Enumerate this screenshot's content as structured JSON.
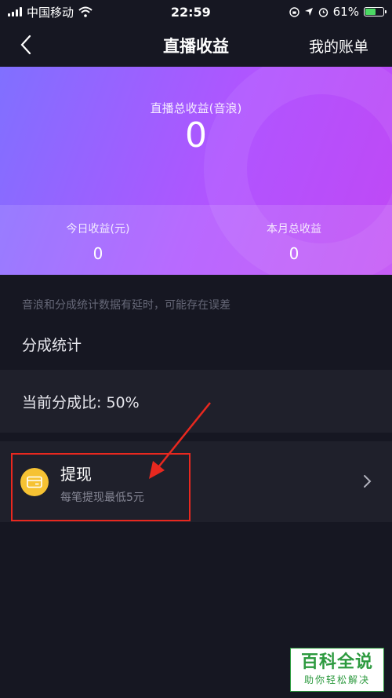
{
  "status_bar": {
    "carrier": "中国移动",
    "time": "22:59",
    "battery_percent": "61%",
    "battery_level": 0.61
  },
  "nav": {
    "title": "直播收益",
    "right_link": "我的账单"
  },
  "earnings": {
    "total_label": "直播总收益(音浪)",
    "total_value": "0",
    "today_label": "今日收益(元)",
    "today_value": "0",
    "month_label": "本月总收益",
    "month_value": "0"
  },
  "notice": "音浪和分成统计数据有延时，可能存在误差",
  "split": {
    "section_title": "分成统计",
    "ratio_text": "当前分成比: 50%"
  },
  "withdraw": {
    "title": "提现",
    "subtitle": "每笔提现最低5元"
  },
  "watermark": {
    "main": "百科全说",
    "sub": "助你轻松解决"
  },
  "colors": {
    "accent_gradient_start": "#8070ff",
    "accent_gradient_end": "#c048f5",
    "background": "#161722",
    "card": "#1f202b",
    "withdraw_icon": "#f6c233",
    "annotation": "#e8281f",
    "watermark_green": "#2d9a3f"
  },
  "icons": {
    "back": "chevron-left-icon",
    "withdraw": "card-icon",
    "row_arrow": "chevron-right-icon",
    "wifi": "wifi-icon",
    "lock": "rotation-lock-icon",
    "location": "location-arrow-icon",
    "alarm": "alarm-icon",
    "battery": "battery-icon"
  }
}
